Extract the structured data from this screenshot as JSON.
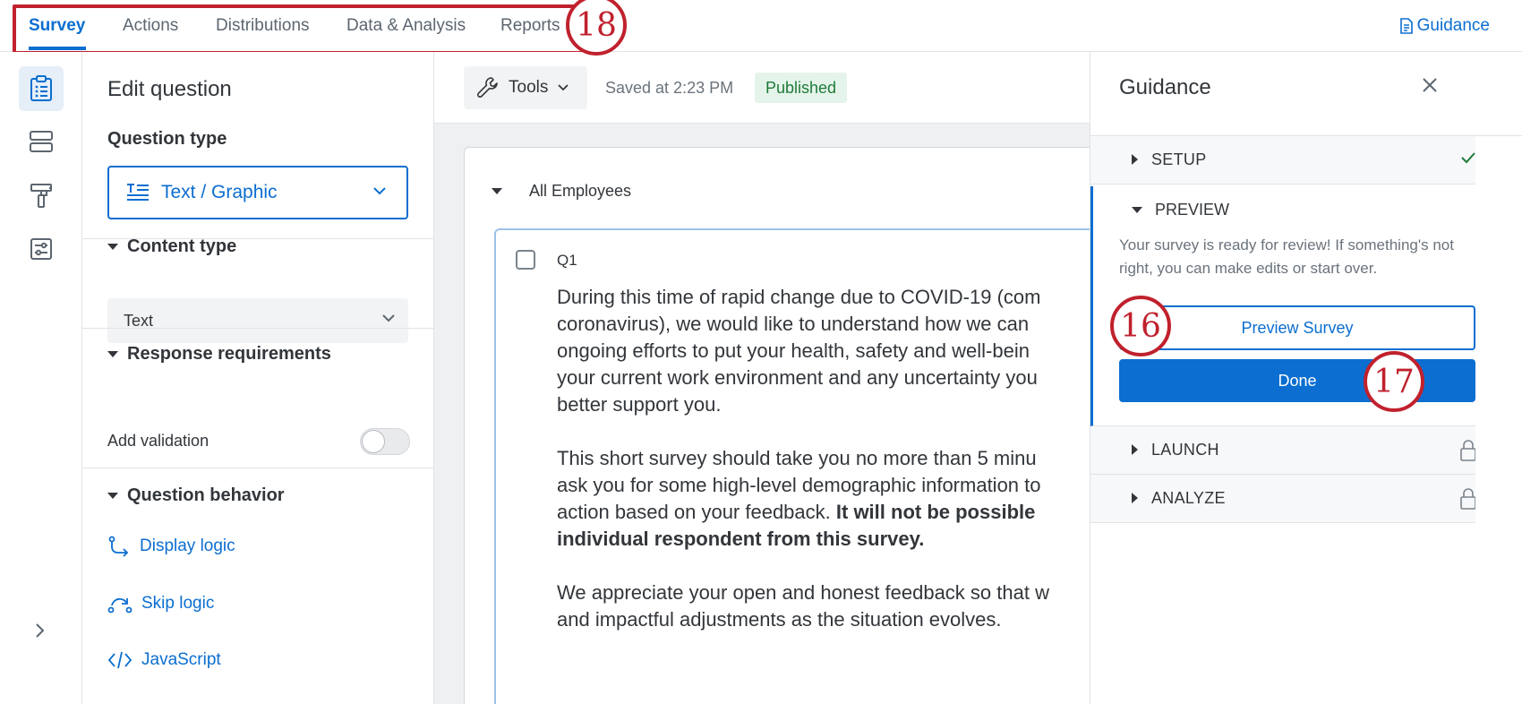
{
  "nav": {
    "tabs": [
      {
        "label": "Survey",
        "active": true
      },
      {
        "label": "Actions"
      },
      {
        "label": "Distributions"
      },
      {
        "label": "Data & Analysis"
      },
      {
        "label": "Reports"
      }
    ],
    "guidance_label": "Guidance"
  },
  "callouts": {
    "c16": "16",
    "c17": "17",
    "c18": "18"
  },
  "rail": {
    "icons": [
      "survey-clipboard-icon",
      "survey-flow-icon",
      "look-and-feel-paint-icon",
      "survey-options-icon"
    ],
    "expand_icon": "chevron-right-icon"
  },
  "edit": {
    "title": "Edit question",
    "question_type_label": "Question type",
    "question_type_value": "Text / Graphic",
    "content_type_label": "Content type",
    "content_type_value": "Text",
    "response_requirements_label": "Response requirements",
    "add_validation_label": "Add validation",
    "add_validation_on": false,
    "question_behavior_label": "Question behavior",
    "display_logic": "Display logic",
    "skip_logic": "Skip logic",
    "javascript": "JavaScript"
  },
  "toolbar": {
    "tools_label": "Tools",
    "saved_text": "Saved at 2:23 PM",
    "status_badge": "Published"
  },
  "block": {
    "name": "All Employees",
    "question": {
      "number": "Q1",
      "p1_lines": [
        "During this time of rapid change due to COVID-19 (com",
        "coronavirus), we would like to understand how we can",
        "ongoing efforts to put your health, safety and well-bein",
        "your current work environment and any uncertainty you",
        "better support you."
      ],
      "p2_lines": [
        "This short survey should take you no more than 5 minu",
        "ask you for some high-level demographic information to",
        "action based on your feedback."
      ],
      "p2_bold_a": "It will not be possible",
      "p2_bold_b": "individual respondent from this survey.",
      "p3_lines": [
        "We appreciate your open and honest feedback so that w",
        "and impactful adjustments as the situation evolves."
      ]
    }
  },
  "guidance": {
    "title": "Guidance",
    "setup": "SETUP",
    "setup_status": "check-icon",
    "preview": "PREVIEW",
    "preview_desc": "Your survey is ready for review! If something's not right, you can make edits or start over.",
    "preview_button": "Preview Survey",
    "done_button": "Done",
    "launch": "LAUNCH",
    "analyze": "ANALYZE",
    "locked_icon": "lock-icon"
  },
  "colors": {
    "accent": "#0b6ed0",
    "callout": "#c0212d",
    "success": "#1f7a3a"
  }
}
